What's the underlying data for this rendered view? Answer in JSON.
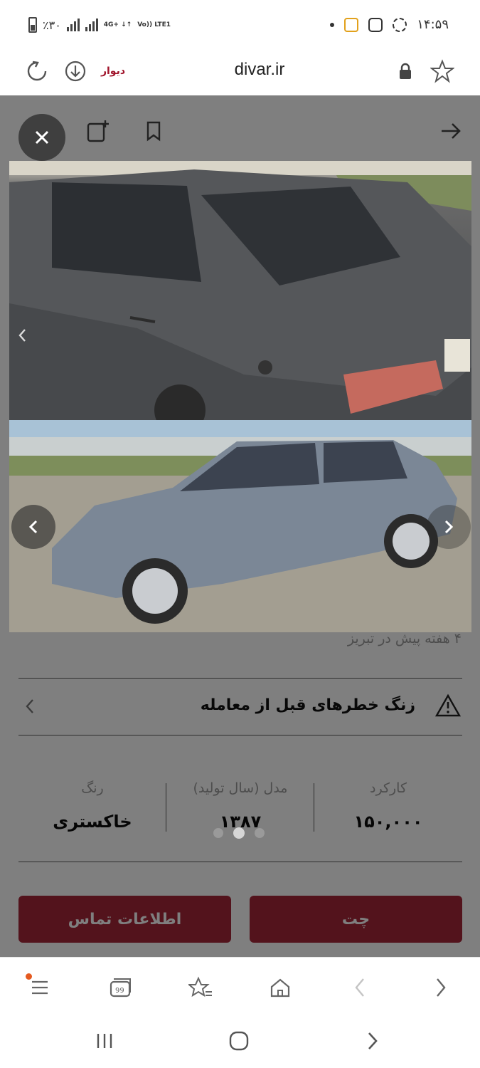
{
  "status_bar": {
    "battery": "٪۳۰",
    "network": "4G+ ↓↑",
    "network2": "Vo)) LTE1",
    "time": "۱۴:۵۹"
  },
  "browser": {
    "domain": "divar.ir",
    "site_logo_text": "دیوار",
    "icons": [
      "reload-icon",
      "download-icon",
      "lock-icon",
      "star-icon"
    ]
  },
  "listing": {
    "meta_line": "۴ هفته پیش در تبریز",
    "warning_label": "زنگ خطرهای قبل از معامله",
    "stats": [
      {
        "key": "کارکرد",
        "value": "۱۵۰,۰۰۰"
      },
      {
        "key": "مدل (سال تولید)",
        "value": "۱۳۸۷"
      },
      {
        "key": "رنگ",
        "value": "خاکستری"
      }
    ],
    "contact_button": "اطلاعات تماس",
    "chat_button": "چت",
    "pager": {
      "count": 3,
      "active_index": 1
    }
  },
  "colors": {
    "accent": "#a62639",
    "overlay": "rgba(0,0,0,0.5)"
  }
}
